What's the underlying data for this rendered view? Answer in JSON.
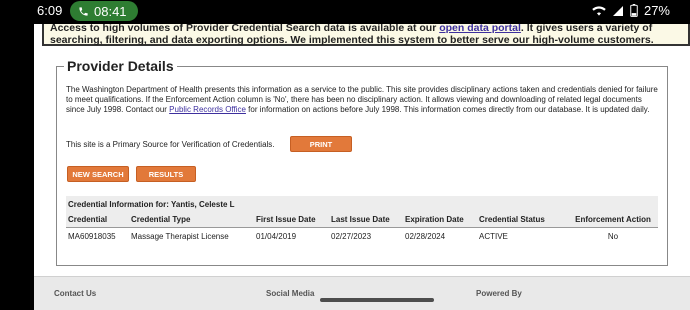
{
  "statusbar": {
    "time": "6:09",
    "call_time": "08:41",
    "battery": "27%"
  },
  "banner": {
    "text_before": "Access to high volumes of Provider Credential Search data is available at our ",
    "link": "open data portal",
    "text_after": ". It gives users a variety of searching, filtering, and data exporting options. We implemented this system to better serve our high-volume customers."
  },
  "provider": {
    "legend": "Provider Details",
    "intro_before": "The Washington Department of Health presents this information as a service to the public. This site provides disciplinary actions taken and credentials denied for failure to meet qualifications. If the Enforcement Action column is 'No', there has been no disciplinary action. It allows viewing and downloading of related legal documents since July 1998. Contact our ",
    "intro_link": "Public Records Office",
    "intro_after": " for information on actions before July 1998. This information comes directly from our database. It is updated daily.",
    "primary_source": "This site is a Primary Source for Verification of Credentials.",
    "print_label": "PRINT",
    "new_search_label": "NEW SEARCH",
    "results_label": "RESULTS"
  },
  "credential": {
    "title": "Credential Information for: Yantis, Celeste L",
    "headers": [
      "Credential",
      "Credential Type",
      "First Issue Date",
      "Last Issue Date",
      "Expiration Date",
      "Credential Status",
      "Enforcement Action"
    ],
    "rows": [
      [
        "MA60918035",
        "Massage Therapist License",
        "01/04/2019",
        "02/27/2023",
        "02/28/2024",
        "ACTIVE",
        "No"
      ]
    ]
  },
  "footer": {
    "contact": "Contact Us",
    "social": "Social Media",
    "powered": "Powered By"
  }
}
